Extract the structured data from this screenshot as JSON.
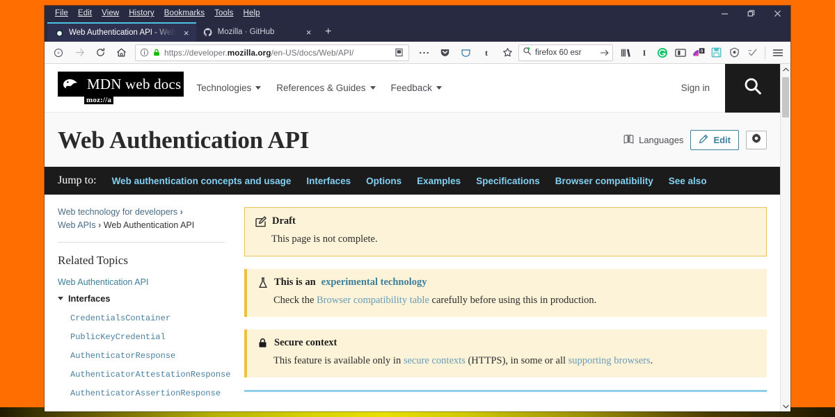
{
  "browser": {
    "menubar": [
      {
        "label": "File",
        "accel": "F"
      },
      {
        "label": "Edit",
        "accel": "E"
      },
      {
        "label": "View",
        "accel": "V"
      },
      {
        "label": "History",
        "accel": "s"
      },
      {
        "label": "Bookmarks",
        "accel": "B"
      },
      {
        "label": "Tools",
        "accel": "T"
      },
      {
        "label": "Help",
        "accel": "H"
      }
    ],
    "window_controls": [
      "minimize-button",
      "restore-button",
      "close-button"
    ],
    "tabs": [
      {
        "title": "Web Authentication API - Web",
        "favicon": "firefox-icon",
        "active": true,
        "close_label": "×"
      },
      {
        "title": "Mozilla · GitHub",
        "favicon": "github-icon",
        "active": false,
        "close_label": "×"
      }
    ],
    "new_tab_label": "+",
    "nav": {
      "back": "back-button",
      "forward": "forward-button",
      "reload": "reload-button",
      "home": "home-button"
    },
    "address_bar": {
      "url_prefix": "https://developer.",
      "url_domain": "mozilla.org",
      "url_suffix": "/en-US/docs/Web/API/",
      "identity_icon": "page-info-icon",
      "lock_icon": "secure-lock-icon",
      "reader_icon": "reader-view-icon",
      "page_actions_icon": "ellipsis-icon",
      "pocket_icon": "pocket-icon",
      "container_icon": "container-tab-icon",
      "bookmark_icon": "star-icon"
    },
    "search_bar": {
      "value": "firefox 60 esr",
      "icon": "search-engine-icon",
      "go_label": "→"
    },
    "toolbar_icons": [
      "library-icon",
      "text-cursor-icon",
      "grammarly-icon",
      "multi-account-containers-icon",
      "firefox-send-icon",
      "save-page-icon",
      "privacy-badger-icon",
      "checkmark-tool-icon",
      "hamburger-menu-icon"
    ],
    "badge_count": "0"
  },
  "mdn": {
    "logo": {
      "wordmark": "MDN web docs",
      "mozilla_tag": "moz://a",
      "dino_icon": "mdn-dinosaur-icon"
    },
    "nav": [
      {
        "label": "Technologies"
      },
      {
        "label": "References & Guides"
      },
      {
        "label": "Feedback"
      }
    ],
    "sign_in": "Sign in",
    "search_button_icon": "search-icon",
    "page_title": "Web Authentication API",
    "actions": {
      "languages": "Languages",
      "languages_icon": "languages-book-icon",
      "edit": "Edit",
      "edit_icon": "pencil-icon",
      "settings_icon": "gear-icon"
    },
    "jump_to": {
      "label": "Jump to:",
      "links": [
        "Web authentication concepts and usage",
        "Interfaces",
        "Options",
        "Examples",
        "Specifications",
        "Browser compatibility",
        "See also"
      ]
    },
    "breadcrumb": [
      {
        "label": "Web technology for developers",
        "link": true
      },
      {
        "label": "Web APIs",
        "link": true
      },
      {
        "label": "Web Authentication API",
        "link": false
      }
    ],
    "breadcrumb_separator": "›",
    "sidebar": {
      "related_topics_heading": "Related Topics",
      "top_link": "Web Authentication API",
      "group_label": "Interfaces",
      "items": [
        "CredentialsContainer",
        "PublicKeyCredential",
        "AuthenticatorResponse",
        "AuthenticatorAttestationResponse",
        "AuthenticatorAssertionResponse"
      ]
    },
    "notices": [
      {
        "id": "draft",
        "icon": "draft-pencil-icon",
        "title": "Draft",
        "body": "This page is not complete."
      },
      {
        "id": "experimental",
        "icon": "flask-icon",
        "title_plain": "This is an ",
        "title_link": "experimental technology",
        "body_pre": "Check the ",
        "body_link": "Browser compatibility table",
        "body_post": " carefully before using this in production."
      },
      {
        "id": "secure-context",
        "icon": "lock-icon",
        "title": "Secure context",
        "body_pre": "This feature is available only in ",
        "body_link1": "secure contexts",
        "body_mid": " (HTTPS), in some or all ",
        "body_link2": "supporting browsers",
        "body_post": "."
      }
    ]
  },
  "colors": {
    "desktop": "#FF6E00",
    "chrome_dark": "#282a42",
    "mdn_dark": "#1b1b1b",
    "link_blue": "#3d7e9a",
    "jump_link": "#83d0f2",
    "notice_bg": "#fdf3d8",
    "notice_border": "#e5c65b",
    "accent_rule": "#8fd0e8"
  }
}
